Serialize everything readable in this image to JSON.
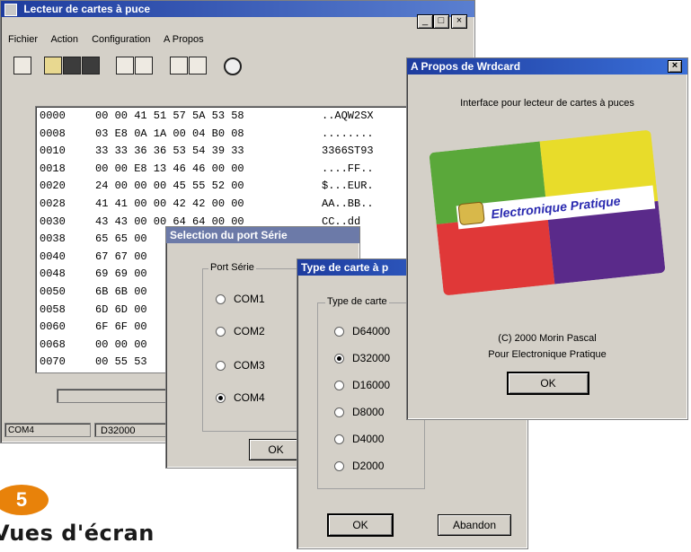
{
  "main_window": {
    "title": "Lecteur de cartes à puce",
    "controls": [
      "_",
      "□",
      "×"
    ],
    "menu": [
      "Fichier",
      "Action",
      "Configuration",
      "A Propos"
    ],
    "hex_rows": [
      {
        "addr": "0000",
        "bytes": "00 00 41 51 57 5A 53 58",
        "ascii": "..AQW2SX"
      },
      {
        "addr": "0008",
        "bytes": "03 E8 0A 1A 00 04 B0 08",
        "ascii": "........"
      },
      {
        "addr": "0010",
        "bytes": "33 33 36 36 53 54 39 33",
        "ascii": "3366ST93"
      },
      {
        "addr": "0018",
        "bytes": "00 00 E8 13 46 46 00 00",
        "ascii": "....FF.."
      },
      {
        "addr": "0020",
        "bytes": "24 00 00 00 45 55 52 00",
        "ascii": "$...EUR."
      },
      {
        "addr": "0028",
        "bytes": "41 41 00 00 42 42 00 00",
        "ascii": "AA..BB.."
      },
      {
        "addr": "0030",
        "bytes": "43 43 00 00 64 64 00 00",
        "ascii": "CC..dd"
      },
      {
        "addr": "0038",
        "bytes": "65 65 00",
        "ascii": ""
      },
      {
        "addr": "0040",
        "bytes": "67 67 00",
        "ascii": ""
      },
      {
        "addr": "0048",
        "bytes": "69 69 00",
        "ascii": ""
      },
      {
        "addr": "0050",
        "bytes": "6B 6B 00",
        "ascii": ""
      },
      {
        "addr": "0058",
        "bytes": "6D 6D 00",
        "ascii": ""
      },
      {
        "addr": "0060",
        "bytes": "6F 6F 00",
        "ascii": ""
      },
      {
        "addr": "0068",
        "bytes": "00 00 00",
        "ascii": ""
      },
      {
        "addr": "0070",
        "bytes": "00 55 53",
        "ascii": ""
      }
    ],
    "status_port": "COM4",
    "status_card": "D32000"
  },
  "port_dialog": {
    "title": "Selection du port Série",
    "group_label": "Port Série",
    "options": [
      "COM1",
      "COM2",
      "COM3",
      "COM4"
    ],
    "selected_index": 3,
    "ok_label": "OK"
  },
  "card_dialog": {
    "title": "Type de carte à p",
    "group_label": "Type de carte",
    "options": [
      "D64000",
      "D32000",
      "D16000",
      "D8000",
      "D4000",
      "D2000"
    ],
    "selected_index": 1,
    "ok_label": "OK",
    "cancel_label": "Abandon"
  },
  "about_dialog": {
    "title": "A Propos de Wrdcard",
    "close": "×",
    "heading": "Interface pour lecteur de cartes à puces",
    "card_text": "Electronique Pratique",
    "copyright": "(C) 2000 Morin Pascal",
    "publisher": "Pour Electronique Pratique",
    "ok_label": "OK"
  },
  "caption": {
    "number": "5",
    "text": "Vues d'écran",
    "accent": "#e8820a"
  }
}
